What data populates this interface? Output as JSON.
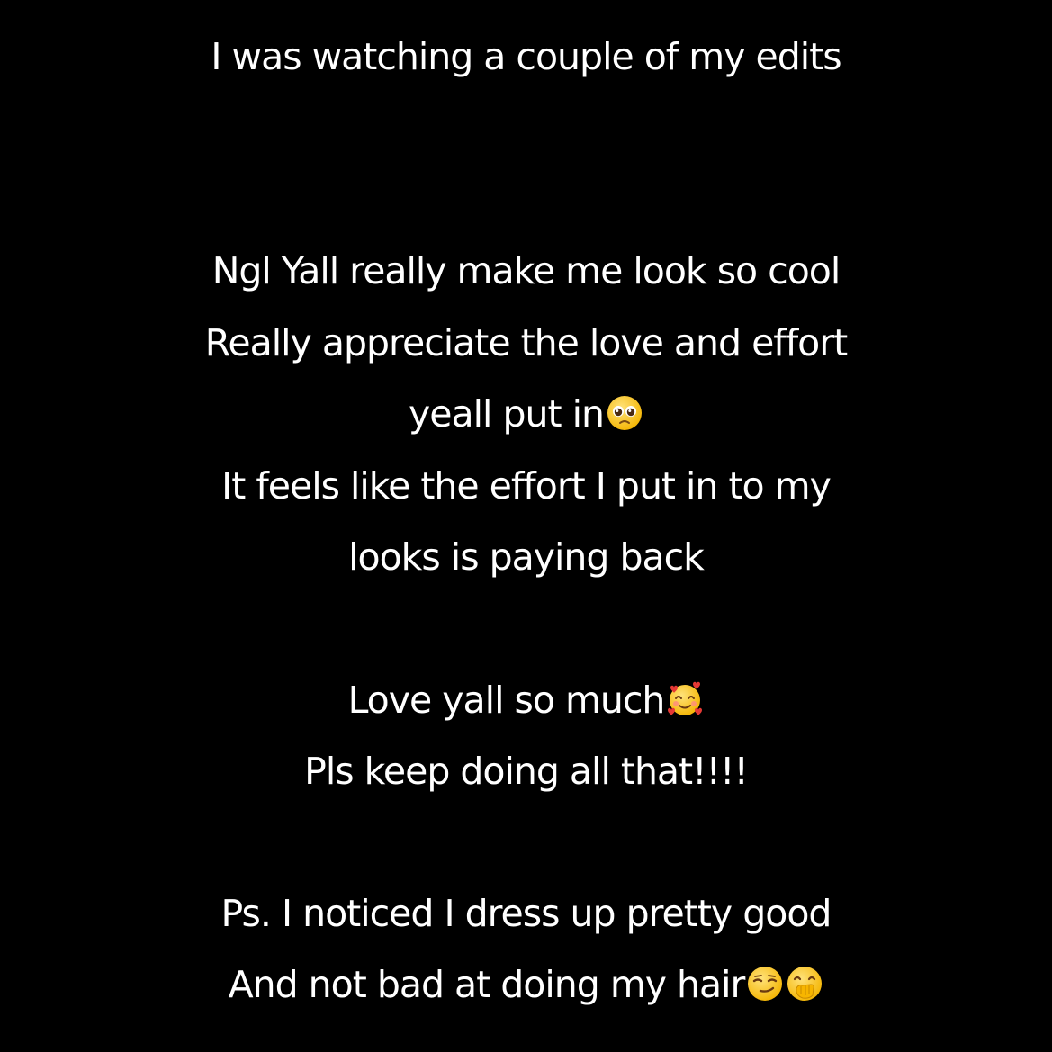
{
  "background_color": "#000000",
  "text_color": "#ffffff",
  "lines": [
    {
      "text": "I was watching a couple of my edits"
    },
    {
      "text": "Ngl Yall really make me look so cool"
    },
    {
      "text": "Really appreciate the love and effort"
    },
    {
      "text": "yeall put in",
      "emoji": [
        "pleading-face-icon"
      ]
    },
    {
      "text": "It feels like the effort I put in to my"
    },
    {
      "text": "looks is paying back"
    },
    {
      "text": "Love yall so much",
      "emoji": [
        "smiling-face-with-hearts-icon"
      ]
    },
    {
      "text": "Pls keep doing all that!!!!"
    },
    {
      "text": "Ps. I noticed I dress up pretty good"
    },
    {
      "text": "And not bad at doing my hair",
      "emoji": [
        "smirking-face-icon",
        "face-with-hand-over-mouth-icon"
      ]
    }
  ]
}
